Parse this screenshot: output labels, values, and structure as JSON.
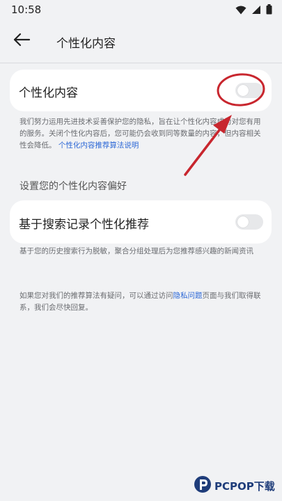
{
  "status_bar": {
    "time": "10:58"
  },
  "header": {
    "title": "个性化内容"
  },
  "personalized_card": {
    "label": "个性化内容",
    "toggle_on": false
  },
  "personalized_desc": {
    "text": "我们努力运用先进技术妥善保护您的隐私，旨在让个性化内容成为对您有用的服务。关闭个性化内容后，您可能仍会收到同等数量的内容，但内容相关性会降低。",
    "link": "个性化内容推荐算法说明"
  },
  "section": {
    "title": "设置您的个性化内容偏好"
  },
  "search_card": {
    "label": "基于搜索记录个性化推荐",
    "toggle_on": false
  },
  "search_desc": {
    "text": "基于您的历史搜索行为脱敏，聚合分组处理后为您推荐感兴趣的新闻资讯"
  },
  "contact_desc": {
    "text_before": "如果您对我们的推荐算法有疑问，可以通过访问",
    "link": "隐私问题",
    "text_after": "页面与我们取得联系，我们会尽快回复。"
  },
  "watermark": {
    "logo": "PCPOP下载"
  },
  "colors": {
    "background": "#f1f2f4",
    "card": "#ffffff",
    "link": "#2d68d6",
    "annotation": "#c8262e"
  },
  "icons": {
    "wifi": "wifi-icon",
    "signal": "signal-icon",
    "battery": "battery-icon",
    "back": "arrow-left-icon"
  }
}
